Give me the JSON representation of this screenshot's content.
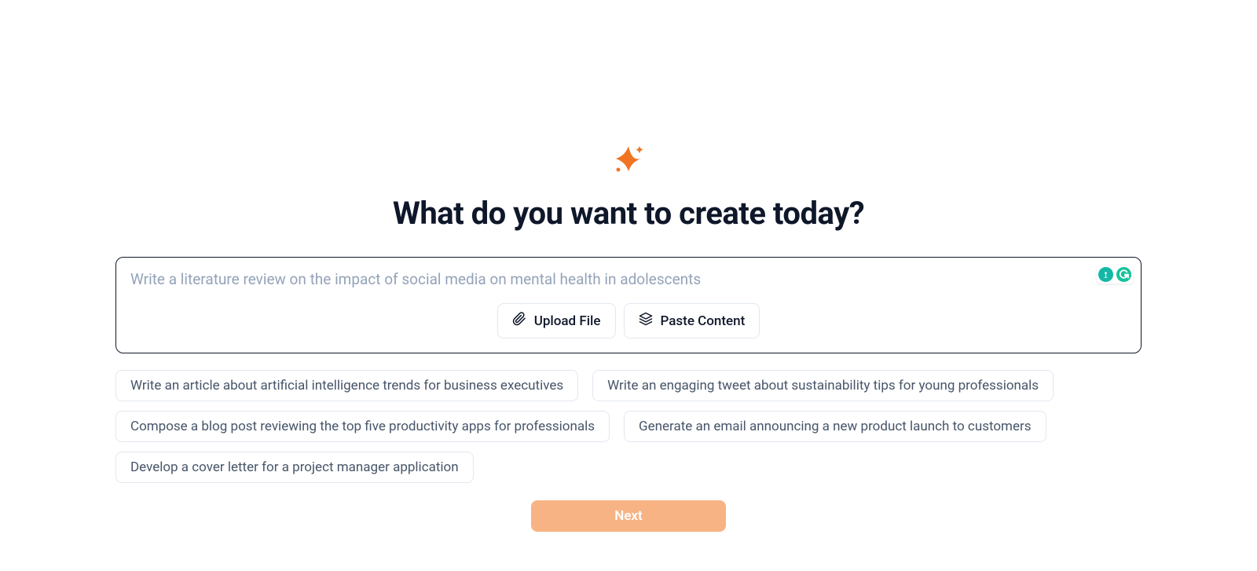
{
  "heading": "What do you want to create today?",
  "input": {
    "placeholder": "Write a literature review on the impact of social media on mental health in adolescents",
    "value": ""
  },
  "actions": {
    "upload_label": "Upload File",
    "paste_label": "Paste Content"
  },
  "suggestions": [
    "Write an article about artificial intelligence trends for business executives",
    "Write an engaging tweet about sustainability tips for young professionals",
    "Compose a blog post reviewing the top five productivity apps for professionals",
    "Generate an email announcing a new product launch to customers",
    "Develop a cover letter for a project manager application"
  ],
  "next_label": "Next",
  "colors": {
    "accent": "#f07422",
    "next_bg": "#f7b384",
    "badge_teal": "#14b8a6",
    "badge_green": "#15c39a"
  }
}
